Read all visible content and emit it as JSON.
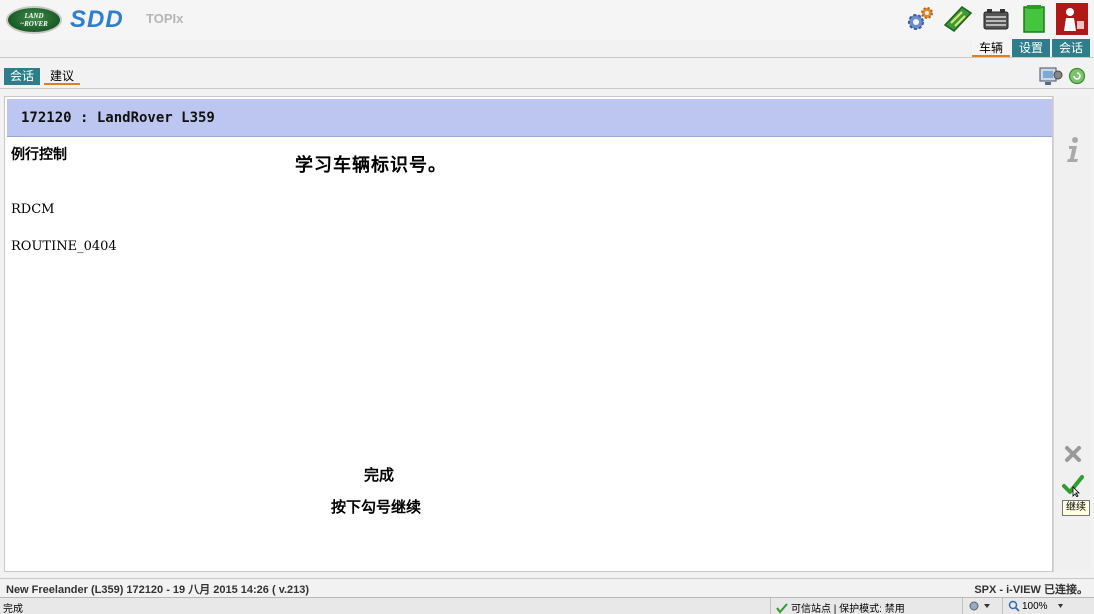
{
  "header": {
    "brand_logo_text": "LAND ROVER",
    "app_name": "SDD",
    "module_name": "TOPIx",
    "tool_icons": [
      "settings-gears-icon",
      "network-card-icon",
      "battery-icon",
      "document-green-icon",
      "user-exit-icon"
    ],
    "tabs": [
      {
        "label": "车辆",
        "active": true
      },
      {
        "label": "设置",
        "active": false
      },
      {
        "label": "会话",
        "active": false
      }
    ]
  },
  "subheader": {
    "tabs": [
      {
        "label": "会话",
        "active": false
      },
      {
        "label": "建议",
        "active": true
      }
    ],
    "icons": [
      "camera-monitor-icon",
      "green-circle-icon"
    ]
  },
  "main": {
    "banner": "172120 : LandRover L359",
    "routine_title": "例行控制",
    "instruction": "学习车辆标识号。",
    "module_code": "RDCM",
    "routine_code": "ROUTINE_0404",
    "status_done": "完成",
    "status_prompt": "按下勾号继续"
  },
  "sidebar": {
    "info_icon": "info-icon",
    "cancel_icon": "cross-icon",
    "continue_icon": "checkmark-icon",
    "tooltip": "继续"
  },
  "footer": {
    "left": "New Freelander (L359) 172120 - 19 八月 2015 14:26 ( v.213)",
    "right": "SPX - i-VIEW 已连接。"
  },
  "browser_status": {
    "left": "完成",
    "trusted_zone": "可信站点 | 保护模式: 禁用",
    "zoom": "100%"
  },
  "colors": {
    "teal_tab": "#2e7d8a",
    "active_underline": "#e07f1f",
    "banner_bg": "#bcc6f0",
    "sdd_blue": "#2f7fcc"
  }
}
